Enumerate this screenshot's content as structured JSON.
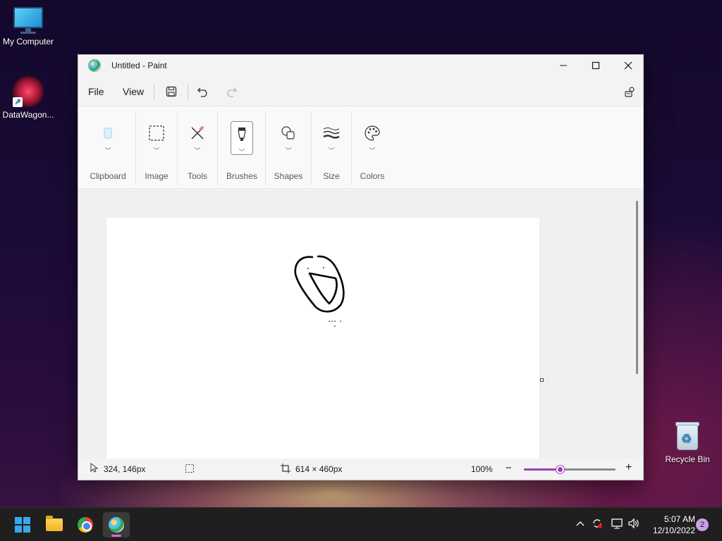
{
  "desktop": {
    "icons": [
      {
        "label": "My Computer",
        "icon": "monitor-icon"
      },
      {
        "label": "DataWagon...",
        "icon": "datawagon-icon"
      },
      {
        "label": "Recycle Bin",
        "icon": "recycle-bin-icon"
      }
    ]
  },
  "window": {
    "title": "Untitled - Paint",
    "menu": {
      "file": "File",
      "view": "View"
    },
    "toolbar_icons": [
      "save-icon",
      "undo-icon",
      "redo-icon",
      "share-icon"
    ],
    "ribbon": {
      "groups": [
        "Clipboard",
        "Image",
        "Tools",
        "Brushes",
        "Shapes",
        "Size",
        "Colors"
      ]
    },
    "status": {
      "cursor_pos": "324, 146px",
      "canvas_size": "614 × 460px",
      "zoom": "100%",
      "zoom_level": 0.4
    }
  },
  "taskbar": {
    "apps": [
      "start-icon",
      "file-explorer-icon",
      "chrome-icon",
      "paint-icon"
    ],
    "active_app": "paint-icon",
    "time": "5:07 AM",
    "date": "12/10/2022",
    "notifications": "2"
  },
  "colors": {
    "accent": "#9c3fb4",
    "taskbar": "#1f1f1f",
    "window_bg": "#f3f3f3"
  }
}
